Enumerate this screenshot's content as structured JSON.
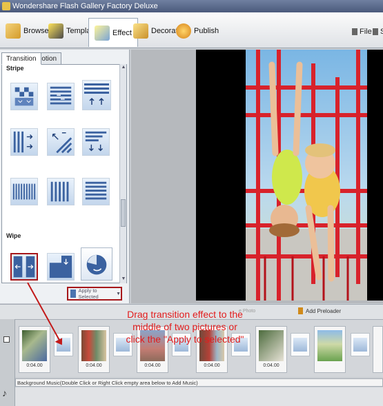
{
  "window": {
    "title": "Wondershare Flash Gallery Factory Deluxe"
  },
  "toolbar": {
    "buttons": [
      {
        "label": "Browse",
        "icon": "browse-icon"
      },
      {
        "label": "Template",
        "icon": "template-icon"
      },
      {
        "label": "Effect",
        "icon": "effect-icon"
      },
      {
        "label": "Decorate",
        "icon": "decorate-icon"
      },
      {
        "label": "Publish",
        "icon": "publish-icon"
      }
    ],
    "right": [
      {
        "label": "File"
      },
      {
        "label": "S"
      }
    ]
  },
  "effects": {
    "tabs": [
      "Transition",
      "Motion"
    ],
    "categories": [
      "Stripe",
      "Wipe"
    ],
    "apply_button": "Apply to Selected"
  },
  "timeline": {
    "faded_label": "e Photo",
    "preloader": "Add Preloader",
    "frames": [
      {
        "duration": "0:04.00"
      },
      {
        "duration": "0:04.00"
      },
      {
        "duration": "0:04.00"
      },
      {
        "duration": "0:04.00"
      },
      {
        "duration": "0:04.00"
      },
      {
        "duration": ""
      }
    ],
    "bg_music": "Background Music(Double Click or Right Click empty area below to Add Music)"
  },
  "annotation": {
    "line1": "Drag transition effect to the",
    "line2": "middle of two pictures or",
    "line3": "click the \"Apply to selected\""
  },
  "colors": {
    "annotation": "#e21c1c",
    "selection_border": "#a7171a"
  }
}
